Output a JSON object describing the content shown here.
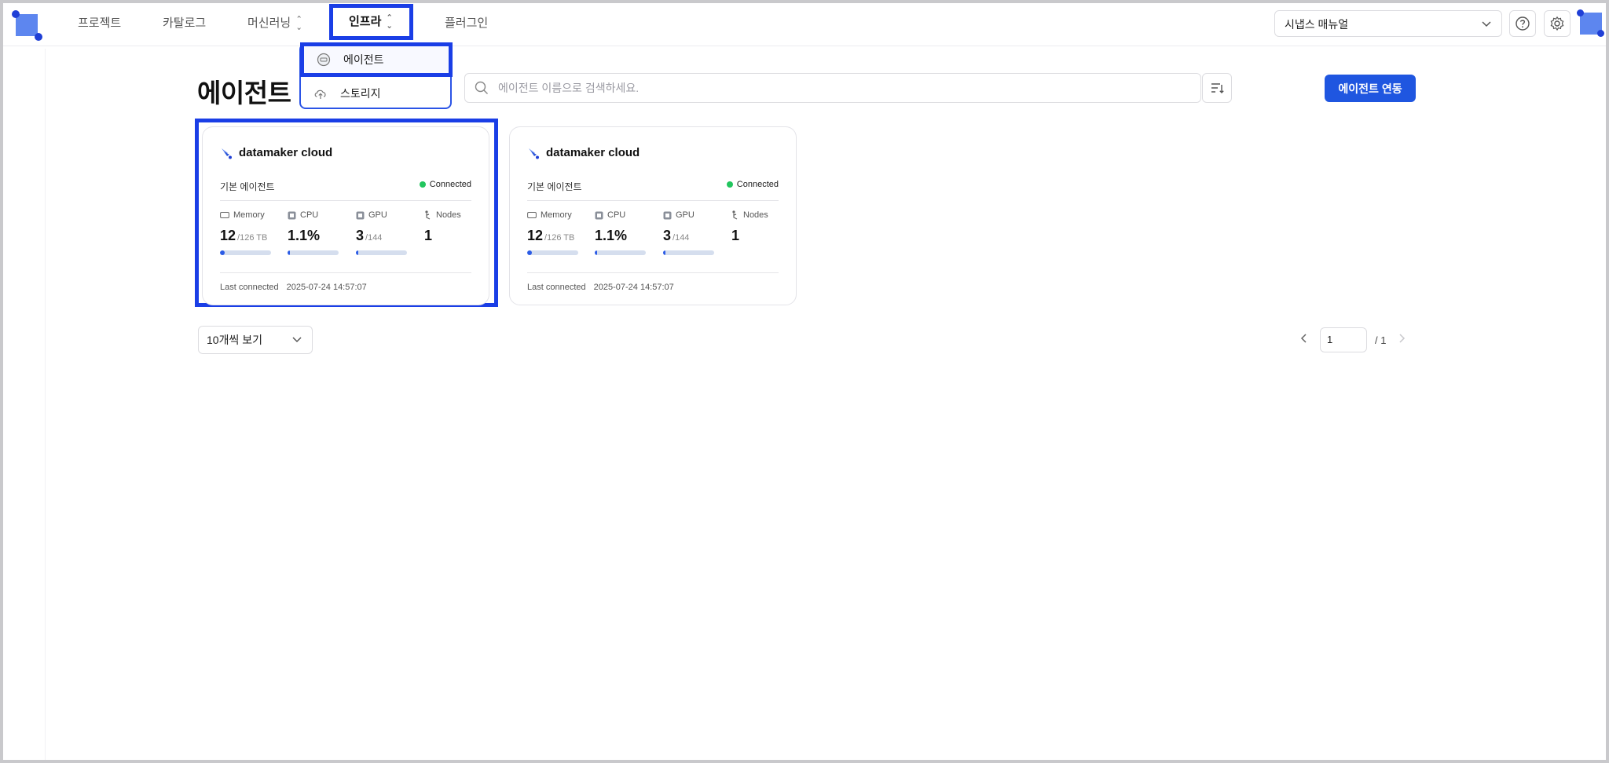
{
  "nav": {
    "items": [
      {
        "label": "프로젝트"
      },
      {
        "label": "카탈로그"
      },
      {
        "label": "머신러닝"
      },
      {
        "label": "인프라"
      },
      {
        "label": "플러그인"
      }
    ]
  },
  "header": {
    "manual_select": "시냅스 매뉴얼"
  },
  "dropdown": {
    "items": [
      {
        "label": "에이전트"
      },
      {
        "label": "스토리지"
      }
    ]
  },
  "page": {
    "title": "에이전트",
    "search_placeholder": "에이전트 이름으로 검색하세요.",
    "connect_button": "에이전트 연동"
  },
  "cards": [
    {
      "name": "datamaker cloud",
      "type": "기본 에이전트",
      "status": "Connected",
      "status_color": "#22c55e",
      "metrics": {
        "memory_label": "Memory",
        "memory_value": "12",
        "memory_total": "/126 TB",
        "memory_usage": 0.095,
        "cpu_label": "CPU",
        "cpu_value": "1.1%",
        "cpu_usage": 0.011,
        "gpu_label": "GPU",
        "gpu_value": "3",
        "gpu_total": "/144",
        "gpu_usage": 0.021,
        "nodes_label": "Nodes",
        "nodes_value": "1"
      },
      "last_connected_label": "Last connected",
      "last_connected_value": "2025-07-24 14:57:07"
    },
    {
      "name": "datamaker cloud",
      "type": "기본 에이전트",
      "status": "Connected",
      "status_color": "#22c55e",
      "metrics": {
        "memory_label": "Memory",
        "memory_value": "12",
        "memory_total": "/126 TB",
        "memory_usage": 0.095,
        "cpu_label": "CPU",
        "cpu_value": "1.1%",
        "cpu_usage": 0.011,
        "gpu_label": "GPU",
        "gpu_value": "3",
        "gpu_total": "/144",
        "gpu_usage": 0.021,
        "nodes_label": "Nodes",
        "nodes_value": "1"
      },
      "last_connected_label": "Last connected",
      "last_connected_value": "2025-07-24 14:57:07"
    }
  ],
  "footer": {
    "per_page": "10개씩 보기",
    "current_page": "1",
    "total_pages": "/ 1"
  },
  "colors": {
    "accent": "#1f56e0",
    "highlight": "#1a3ee6"
  }
}
